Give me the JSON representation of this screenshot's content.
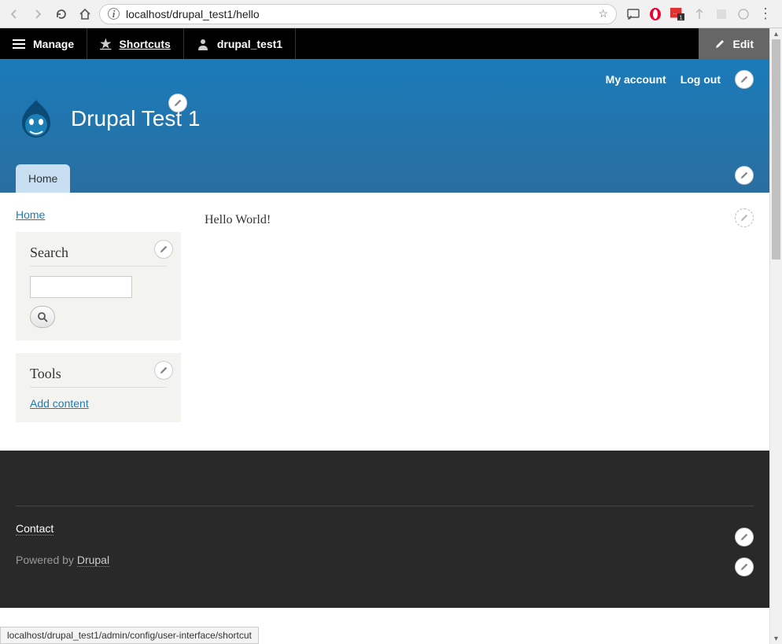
{
  "browser": {
    "url": "localhost/drupal_test1/hello",
    "status_bar": "localhost/drupal_test1/admin/config/user-interface/shortcut"
  },
  "admin_toolbar": {
    "manage": "Manage",
    "shortcuts": "Shortcuts",
    "user": "drupal_test1",
    "edit": "Edit"
  },
  "header": {
    "user_menu": {
      "account": "My account",
      "logout": "Log out"
    },
    "site_name": "Drupal Test 1",
    "primary_nav": {
      "home": "Home"
    }
  },
  "breadcrumb": {
    "home": "Home"
  },
  "sidebar": {
    "search": {
      "title": "Search",
      "value": ""
    },
    "tools": {
      "title": "Tools",
      "add_content": "Add content"
    }
  },
  "content": {
    "body": "Hello World!"
  },
  "footer": {
    "contact": "Contact",
    "powered_prefix": "Powered by ",
    "powered_link": "Drupal"
  },
  "icons": {
    "back": "back-icon",
    "forward": "forward-icon",
    "reload": "reload-icon",
    "home": "home-icon",
    "info": "info-icon",
    "star": "star-icon",
    "cast": "cast-icon",
    "opera": "opera-icon",
    "ext1": "extension-icon",
    "menu": "dots-icon",
    "hamburger": "hamburger-icon",
    "shortcuts_star": "star-icon",
    "user": "user-icon",
    "pencil": "pencil-icon",
    "search": "search-icon"
  }
}
